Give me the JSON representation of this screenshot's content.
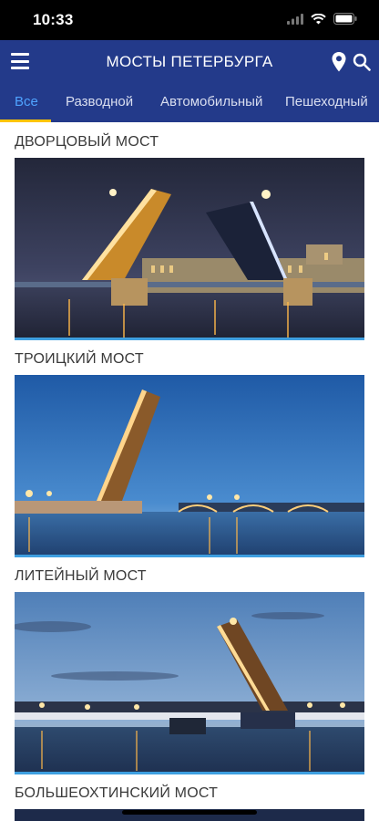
{
  "status_bar": {
    "time": "10:33"
  },
  "header": {
    "title": "МОСТЫ ПЕТЕРБУРГА",
    "menu_icon": "menu-icon",
    "map_icon": "map-pin-icon",
    "search_icon": "search-icon"
  },
  "tabs": [
    {
      "label": "Все",
      "active": true
    },
    {
      "label": "Разводной",
      "active": false
    },
    {
      "label": "Автомобильный",
      "active": false
    },
    {
      "label": "Пешеходный",
      "active": false
    }
  ],
  "bridges": [
    {
      "name": "ДВОРЦОВЫЙ МОСТ"
    },
    {
      "name": "ТРОИЦКИЙ МОСТ"
    },
    {
      "name": "ЛИТЕЙНЫЙ МОСТ"
    },
    {
      "name": "БОЛЬШЕОХТИНСКИЙ МОСТ"
    }
  ],
  "colors": {
    "brand": "#233a8a",
    "active_tab": "#4fa3ff",
    "tab_indicator": "#ffc400",
    "photo_border": "#3e9fe0"
  }
}
